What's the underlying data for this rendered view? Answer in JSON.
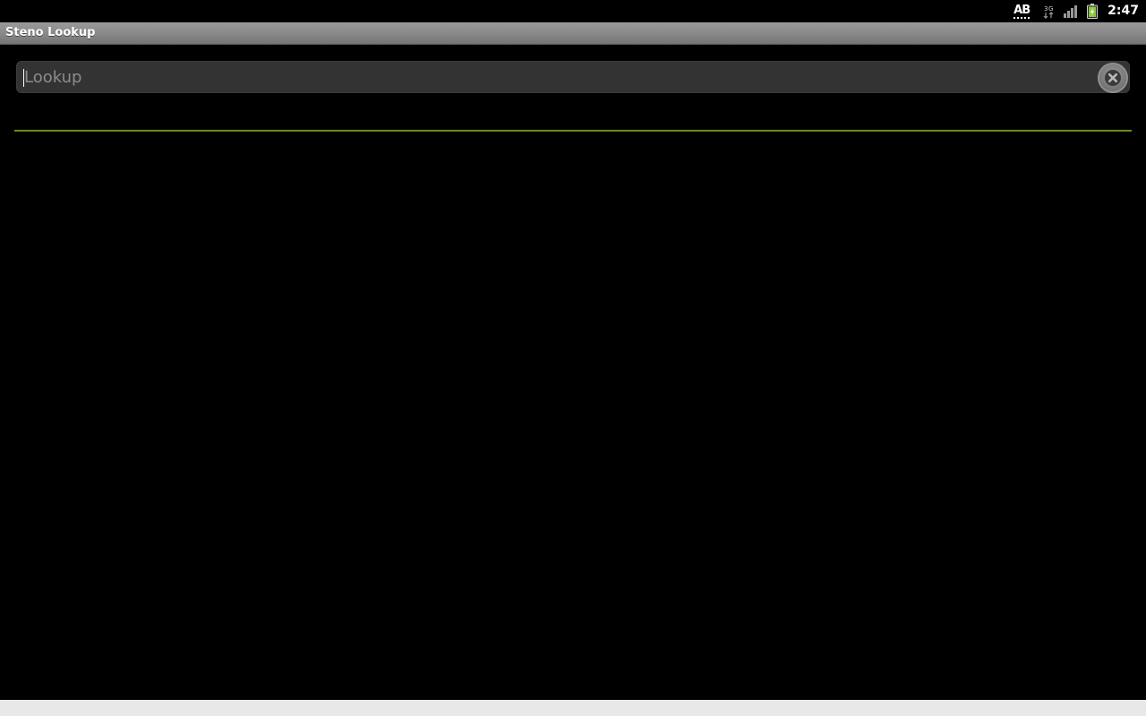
{
  "status_bar": {
    "ime_label": "AB",
    "network_type": "3G",
    "clock": "2:47",
    "icons": [
      "keyboard-ime-icon",
      "data-3g-icon",
      "signal-strength-icon",
      "battery-icon"
    ],
    "colors": {
      "battery_fill": "#8cc63f"
    }
  },
  "app": {
    "title": "Steno Lookup"
  },
  "search": {
    "value": "",
    "placeholder": "Lookup",
    "clear_icon": "close-circle-icon"
  },
  "divider": {
    "color": "#6c8a1e"
  },
  "results": []
}
